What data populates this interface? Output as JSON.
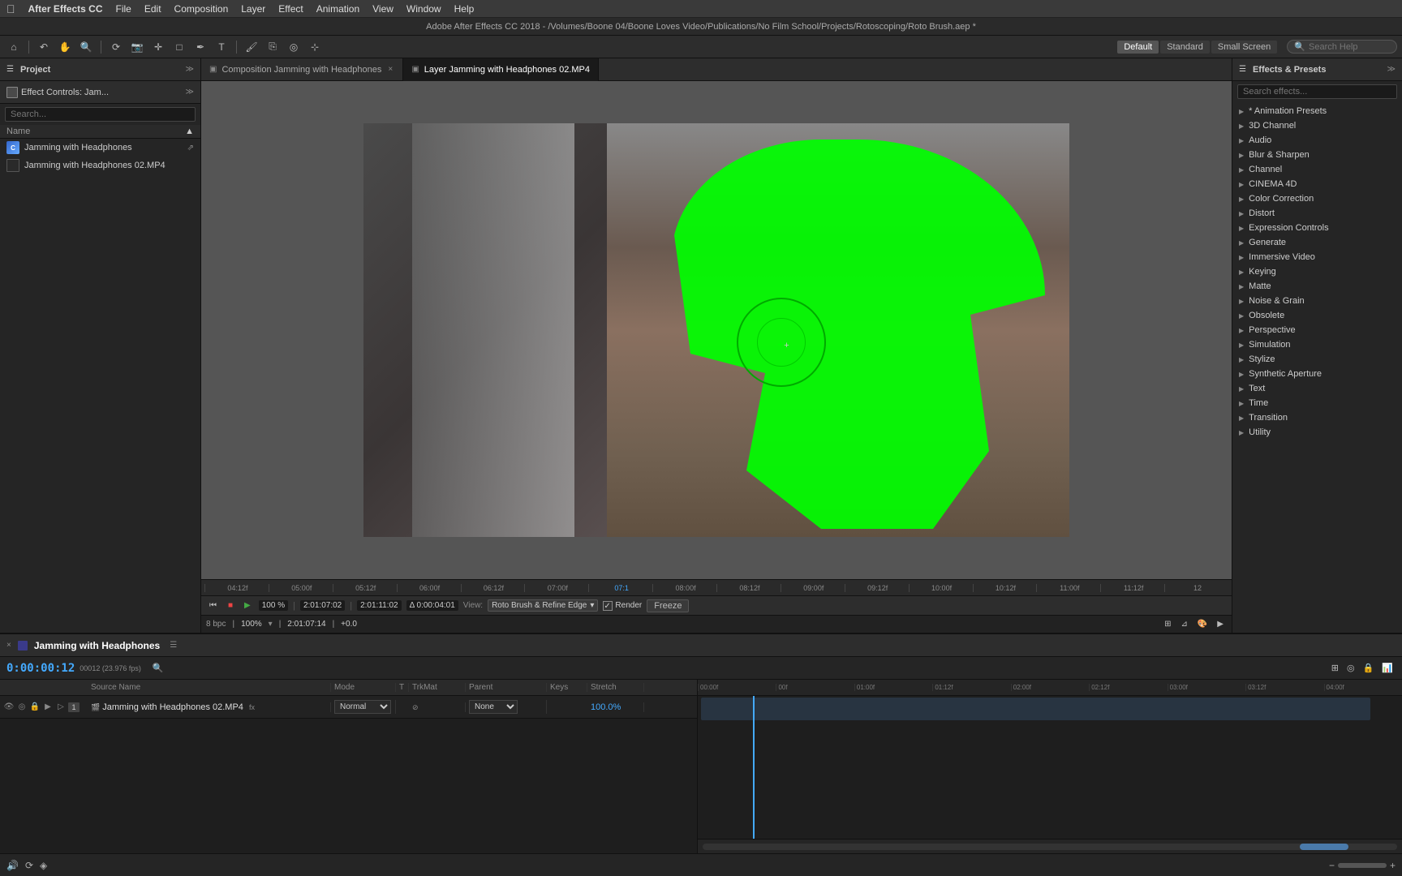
{
  "menubar": {
    "apple": "&#63743;",
    "app": "After Effects CC",
    "menus": [
      "File",
      "Edit",
      "Composition",
      "Layer",
      "Effect",
      "Animation",
      "View",
      "Window",
      "Help"
    ]
  },
  "titlebar": {
    "text": "Adobe After Effects CC 2018 - /Volumes/Boone 04/Boone Loves Video/Publications/No Film School/Projects/Rotoscoping/Roto Brush.aep *"
  },
  "toolbar": {
    "workspace_tabs": [
      "Default",
      "Standard",
      "Small Screen"
    ],
    "search_placeholder": "Search Help"
  },
  "project_panel": {
    "title": "Project",
    "effect_controls_tab": "Effect Controls: Jam...",
    "search_placeholder": "Search...",
    "columns": {
      "name": "Name"
    },
    "items": [
      {
        "id": 1,
        "name": "Jamming with Headphones",
        "type": "comp",
        "selected": false
      },
      {
        "id": 2,
        "name": "Jamming with Headphones 02.MP4",
        "type": "footage",
        "selected": false
      }
    ]
  },
  "viewer": {
    "tabs": [
      {
        "id": "comp",
        "label": "Composition Jamming with Headphones",
        "active": false
      },
      {
        "id": "layer",
        "label": "Layer Jamming with Headphones 02.MP4",
        "active": true
      }
    ],
    "ruler_marks": [
      "04:12f",
      "05:00f",
      "05:12f",
      "06:00f",
      "06:12f",
      "07:00f",
      "07:1",
      "08:00f",
      "08:12f",
      "09:00f",
      "09:12f",
      "10:00f",
      "10:12f",
      "11:00f",
      "11:12f",
      "12"
    ],
    "controls": {
      "zoom": "100 %",
      "timecode1": "2:01:07:02",
      "timecode2": "2:01:11:02",
      "delta": "Δ 0:00:04:01",
      "view_label": "View:",
      "view_dropdown": "Roto Brush & Refine Edge",
      "render_checkbox": "Render",
      "freeze_btn": "Freeze"
    },
    "bottom": {
      "bpc": "8 bpc",
      "zoom2": "100%",
      "timecode3": "2:01:07:14",
      "offset": "+0.0"
    }
  },
  "effects_panel": {
    "title": "Effects & Presets",
    "search_placeholder": "Search effects...",
    "items": [
      {
        "id": 1,
        "name": "* Animation Presets",
        "has_arrow": true
      },
      {
        "id": 2,
        "name": "3D Channel",
        "has_arrow": true
      },
      {
        "id": 3,
        "name": "Audio",
        "has_arrow": true
      },
      {
        "id": 4,
        "name": "Blur & Sharpen",
        "has_arrow": true
      },
      {
        "id": 5,
        "name": "Channel",
        "has_arrow": true
      },
      {
        "id": 6,
        "name": "CINEMA 4D",
        "has_arrow": true
      },
      {
        "id": 7,
        "name": "Color Correction",
        "has_arrow": true
      },
      {
        "id": 8,
        "name": "Distort",
        "has_arrow": true
      },
      {
        "id": 9,
        "name": "Expression Controls",
        "has_arrow": true
      },
      {
        "id": 10,
        "name": "Generate",
        "has_arrow": true
      },
      {
        "id": 11,
        "name": "Immersive Video",
        "has_arrow": true
      },
      {
        "id": 12,
        "name": "Keying",
        "has_arrow": true
      },
      {
        "id": 13,
        "name": "Matte",
        "has_arrow": true
      },
      {
        "id": 14,
        "name": "Noise & Grain",
        "has_arrow": true
      },
      {
        "id": 15,
        "name": "Obsolete",
        "has_arrow": true
      },
      {
        "id": 16,
        "name": "Perspective",
        "has_arrow": true
      },
      {
        "id": 17,
        "name": "Simulation",
        "has_arrow": true
      },
      {
        "id": 18,
        "name": "Stylize",
        "has_arrow": true
      },
      {
        "id": 19,
        "name": "Synthetic Aperture",
        "has_arrow": true
      },
      {
        "id": 20,
        "name": "Text",
        "has_arrow": true
      },
      {
        "id": 21,
        "name": "Time",
        "has_arrow": true
      },
      {
        "id": 22,
        "name": "Transition",
        "has_arrow": true
      },
      {
        "id": 23,
        "name": "Utility",
        "has_arrow": true
      }
    ]
  },
  "timeline": {
    "comp_name": "Jamming with Headphones",
    "timecode": "0:00:00:12",
    "fps_info": "00012 (23.976 fps)",
    "columns": [
      "Source Name",
      "Mode",
      "T",
      "TrkMat",
      "Parent",
      "Keys",
      "Stretch"
    ],
    "rows": [
      {
        "num": "1",
        "name": "Jamming with Headphones 02.MP4",
        "mode": "Normal",
        "parent": "None",
        "stretch": "100.0%"
      }
    ],
    "ruler_marks": [
      "00:00f",
      "00f",
      "01:00f",
      "01:12f",
      "02:00f",
      "02:12f",
      "03:00f",
      "03:12f",
      "04:00f"
    ]
  }
}
